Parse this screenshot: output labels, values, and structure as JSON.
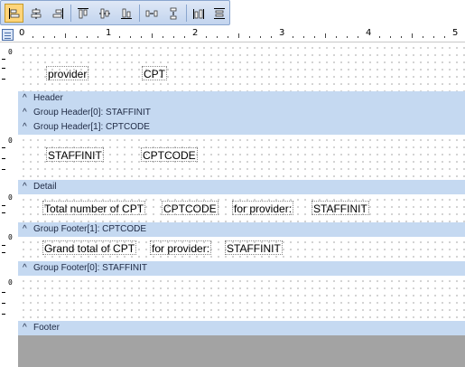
{
  "toolbar": {
    "buttons": [
      {
        "icon": "align-left-icon",
        "active": true
      },
      {
        "icon": "align-center-icon"
      },
      {
        "icon": "align-right-icon"
      },
      {
        "icon": "align-top-icon"
      },
      {
        "icon": "align-middle-icon"
      },
      {
        "icon": "align-bottom-icon"
      },
      {
        "icon": "horizontal-spacing-icon"
      },
      {
        "icon": "vertical-spacing-icon"
      },
      {
        "icon": "same-width-icon"
      },
      {
        "icon": "same-height-icon"
      }
    ]
  },
  "ruler": {
    "labels": [
      "0",
      "1",
      "2",
      "3",
      "4",
      "5"
    ]
  },
  "sections": {
    "page_header": {
      "fields": {
        "provider": "provider",
        "cpt": "CPT"
      }
    },
    "header": {
      "label": "Header"
    },
    "group_header_0": {
      "label": "Group Header[0]: STAFFINIT"
    },
    "group_header_1": {
      "label": "Group Header[1]: CPTCODE",
      "fields": {
        "staffinit": "STAFFINIT",
        "cptcode": "CPTCODE"
      }
    },
    "detail": {
      "label": "Detail",
      "fields": {
        "total_label": "Total number of CPT",
        "cptcode": "CPTCODE",
        "for_provider": "for provider:",
        "staffinit": "STAFFINIT"
      }
    },
    "group_footer_1": {
      "label": "Group Footer[1]: CPTCODE",
      "fields": {
        "grand_total_label": "Grand total of CPT",
        "for_provider": "for provider:",
        "staffinit": "STAFFINIT"
      }
    },
    "group_footer_0": {
      "label": "Group Footer[0]: STAFFINIT"
    },
    "footer": {
      "label": "Footer"
    }
  },
  "left_ruler": {
    "zero": "0"
  },
  "colors": {
    "band": "#c5d9f1",
    "toolbar": "#c2d4ee",
    "active_button": "#ffd57a",
    "empty_area": "#a3a3a3"
  }
}
